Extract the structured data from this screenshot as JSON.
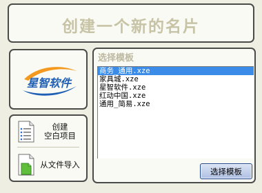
{
  "header": {
    "title": "创建一个新的名片"
  },
  "logo": {
    "text": "星智软件",
    "icon": "xingzhi-logo"
  },
  "actions": {
    "create_label_line1": "创建",
    "create_label_line2": "空白项目",
    "create_icon": "document-list-icon",
    "import_label": "从文件导入",
    "import_icon": "file-import-icon"
  },
  "templates": {
    "section_title": "选择模板",
    "items": [
      "商务_通用.xze",
      "家具城.xze",
      "星智软件.xze",
      "红动中国.xze",
      "通用_简易.xze"
    ],
    "selected_index": 0,
    "button_label": "选择模板"
  },
  "colors": {
    "background": "#efeee3",
    "panel_border": "#4a4a48",
    "title_text": "#c7c3a5",
    "selection": "#3a8ce8",
    "logo_blue": "#1e5fb4",
    "logo_orange": "#f39a1e"
  }
}
